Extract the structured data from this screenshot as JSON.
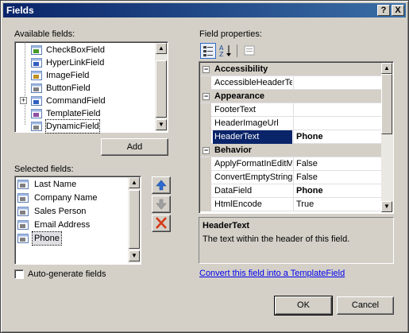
{
  "window": {
    "title": "Fields",
    "help_btn": "?",
    "close_btn": "X"
  },
  "available": {
    "label": "Available fields:",
    "items": [
      {
        "label": "CheckBoxField",
        "icon": "checkbox-field-icon"
      },
      {
        "label": "HyperLinkField",
        "icon": "hyperlink-field-icon"
      },
      {
        "label": "ImageField",
        "icon": "image-field-icon"
      },
      {
        "label": "ButtonField",
        "icon": "button-field-icon"
      },
      {
        "label": "CommandField",
        "icon": "command-field-icon"
      },
      {
        "label": "TemplateField",
        "icon": "template-field-icon"
      },
      {
        "label": "DynamicField",
        "icon": "dynamic-field-icon"
      }
    ],
    "add_label": "Add"
  },
  "selected": {
    "label": "Selected fields:",
    "items": [
      "Last Name",
      "Company Name",
      "Sales Person",
      "Email Address",
      "Phone"
    ],
    "selected_item": "Phone"
  },
  "autogen": {
    "label": "Auto-generate fields",
    "checked": false
  },
  "props": {
    "label": "Field properties:",
    "categories": [
      {
        "name": "Accessibility",
        "rows": [
          {
            "name": "AccessibleHeaderTe",
            "value": ""
          }
        ]
      },
      {
        "name": "Appearance",
        "rows": [
          {
            "name": "FooterText",
            "value": ""
          },
          {
            "name": "HeaderImageUrl",
            "value": ""
          },
          {
            "name": "HeaderText",
            "value": "Phone",
            "selected": true
          }
        ]
      },
      {
        "name": "Behavior",
        "rows": [
          {
            "name": "ApplyFormatInEditM",
            "value": "False"
          },
          {
            "name": "ConvertEmptyString",
            "value": "False"
          },
          {
            "name": "DataField",
            "value": "Phone"
          },
          {
            "name": "HtmlEncode",
            "value": "True"
          }
        ]
      }
    ],
    "desc_title": "HeaderText",
    "desc_text": "The text within the header of this field."
  },
  "convert_link": "Convert this field into a TemplateField",
  "ok_label": "OK",
  "cancel_label": "Cancel",
  "colors": {
    "selection": "#0a246a",
    "link": "#0000ee"
  }
}
